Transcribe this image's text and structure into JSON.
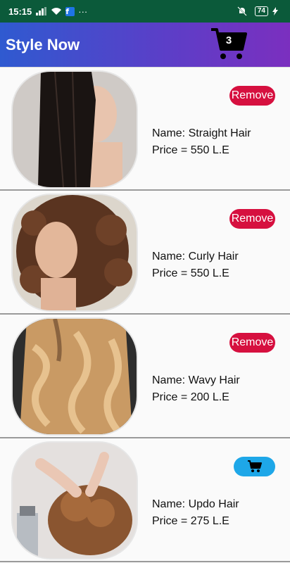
{
  "status_bar": {
    "time": "15:15",
    "more": "···",
    "battery": "74"
  },
  "app_bar": {
    "title": "Style Now",
    "cart_count": "3"
  },
  "items": [
    {
      "name": "Name: Straight Hair",
      "price": "Price = 550 L.E",
      "action": "Remove"
    },
    {
      "name": "Name: Curly Hair",
      "price": "Price = 550 L.E",
      "action": "Remove"
    },
    {
      "name": "Name: Wavy Hair",
      "price": "Price = 200 L.E",
      "action": "Remove"
    },
    {
      "name": "Name: Updo Hair",
      "price": "Price = 275 L.E",
      "action": "add-to-cart-icon"
    }
  ],
  "colors": {
    "status_bar": "#0b5a3a",
    "remove_button": "#d6103f",
    "add_button": "#1ea7e8"
  }
}
